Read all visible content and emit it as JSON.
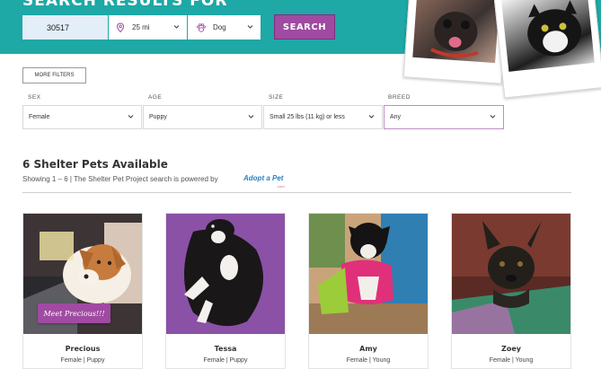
{
  "header": {
    "title": "SEARCH RESULTS FOR",
    "zip_value": "30517",
    "distance": "25 mi",
    "pet_type": "Dog",
    "search_label": "SEARCH"
  },
  "filters": {
    "more_filters_label": "MORE FILTERS",
    "sex": {
      "label": "SEX",
      "value": "Female"
    },
    "age": {
      "label": "AGE",
      "value": "Puppy"
    },
    "size": {
      "label": "SIZE",
      "value": "Small 25 lbs (11 kg) or less"
    },
    "breed": {
      "label": "BREED",
      "value": "Any"
    }
  },
  "results": {
    "count_title": "6 Shelter Pets Available",
    "showing_text": "Showing 1 – 6  |  The Shelter Pet Project search is powered by",
    "powered_by_logo": "Adopt a Pet",
    "powered_by_sub": ".com"
  },
  "pets": [
    {
      "name": "Precious",
      "info": "Female | Puppy",
      "cta": "Meet Precious!!!"
    },
    {
      "name": "Tessa",
      "info": "Female | Puppy"
    },
    {
      "name": "Amy",
      "info": "Female | Young"
    },
    {
      "name": "Zoey",
      "info": "Female | Young"
    }
  ],
  "colors": {
    "hero_teal": "#1ea8a6",
    "accent_purple": "#a04aa2",
    "zip_bg": "#e3eef8"
  },
  "icons": [
    "location-pin-icon",
    "paw-icon",
    "chevron-down-icon"
  ]
}
